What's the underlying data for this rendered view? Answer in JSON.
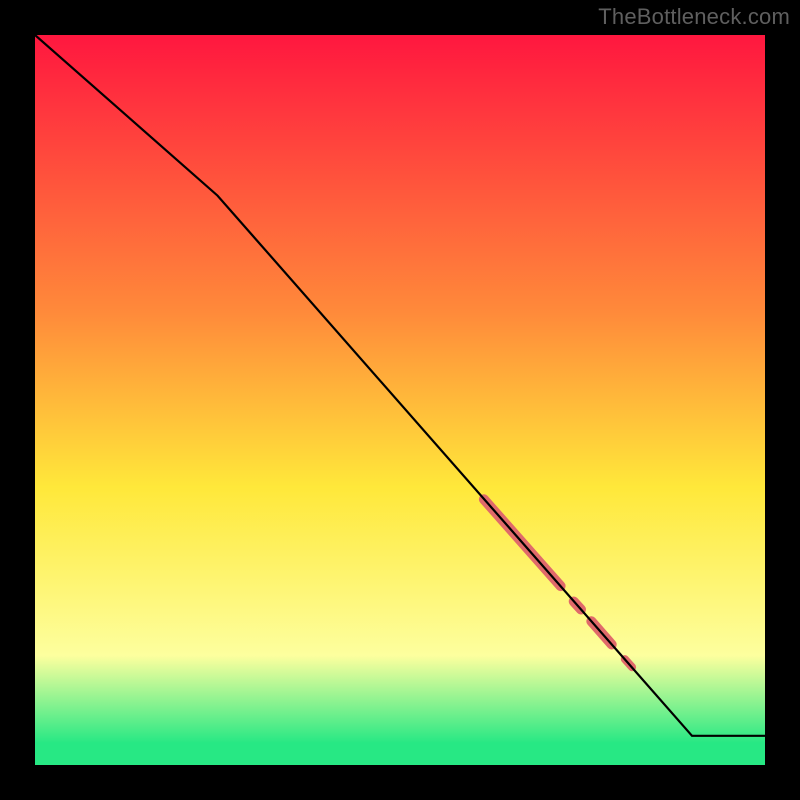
{
  "attribution": "TheBottleneck.com",
  "colors": {
    "page_bg": "#000000",
    "attribution_text": "#5f5f5f",
    "curve": "#000000",
    "marker": "#e06a6a",
    "gradient": {
      "top": "#ff173f",
      "mid_orange": "#ff8a3a",
      "yellow": "#ffe83a",
      "pale": "#fdff9e",
      "green": "#27e884"
    }
  },
  "chart_data": {
    "type": "line",
    "title": "",
    "xlabel": "",
    "ylabel": "",
    "xlim": [
      0,
      100
    ],
    "ylim": [
      0,
      100
    ],
    "grid": false,
    "legend": false,
    "curve": [
      {
        "x": 0,
        "y": 100
      },
      {
        "x": 25,
        "y": 78
      },
      {
        "x": 90,
        "y": 4
      },
      {
        "x": 100,
        "y": 4
      }
    ],
    "marker_segments": [
      {
        "x1": 61.5,
        "y1": 36.4,
        "x2": 72.0,
        "y2": 24.5,
        "w": 10
      },
      {
        "x1": 73.8,
        "y1": 22.4,
        "x2": 74.8,
        "y2": 21.3,
        "w": 10
      },
      {
        "x1": 76.2,
        "y1": 19.7,
        "x2": 79.0,
        "y2": 16.5,
        "w": 10
      },
      {
        "x1": 80.8,
        "y1": 14.5,
        "x2": 81.8,
        "y2": 13.4,
        "w": 8
      }
    ]
  }
}
